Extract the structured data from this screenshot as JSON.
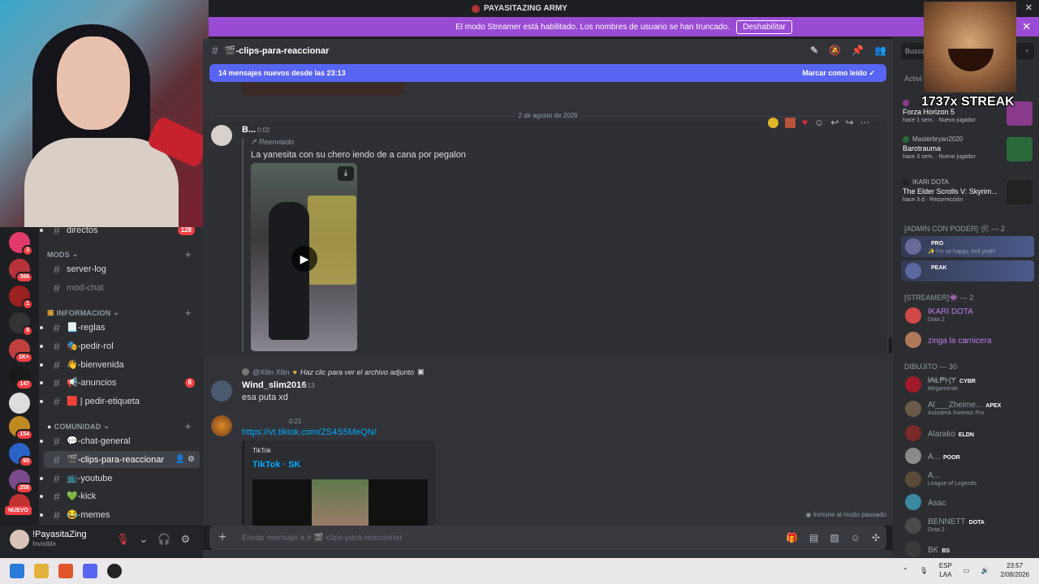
{
  "window": {
    "title": "PAYASITAZING ARMY",
    "controls": [
      "—",
      "☐",
      "✕"
    ]
  },
  "banner": {
    "text": "El modo Streamer está habilitado. Los nombres de usuario se han truncado.",
    "button": "Deshabilitar",
    "close": "✕"
  },
  "servers": [
    {
      "badge": "3",
      "color": "#e23a6a"
    },
    {
      "badge": "366",
      "color": "#b8323a"
    },
    {
      "badge": "1",
      "color": "#9b2020"
    },
    {
      "badge": "8",
      "color": "#333"
    },
    {
      "badge": "1K+",
      "color": "#c04040"
    },
    {
      "badge": "147",
      "color": "#1a1a1a"
    },
    {
      "badge": "",
      "color": "#ddd"
    },
    {
      "badge": "154",
      "color": "#c08a22",
      "label": "GATITOS ARMY"
    },
    {
      "badge": "60",
      "color": "#2a62c8"
    },
    {
      "badge": "258",
      "color": "#7a4a8a"
    },
    {
      "badge": "",
      "color": "#c03030"
    }
  ],
  "server_new_label": "NUEVO",
  "channels": {
    "top": {
      "name": "directos",
      "badge": "128"
    },
    "cat_mods": "MODS",
    "mods": [
      {
        "name": "server-log",
        "muted": false
      },
      {
        "name": "mod-chat",
        "muted": true
      }
    ],
    "cat_info": "INFORMACION",
    "info": [
      {
        "name": "📃-reglas"
      },
      {
        "name": "🎭-pedir-rol"
      },
      {
        "name": "👋-bienvenida"
      },
      {
        "name": "📢-anuncios",
        "badge": "8"
      },
      {
        "name": "🟥 | pedir-etiqueta"
      }
    ],
    "cat_com": "COMUNIDAD",
    "com": [
      {
        "name": "💬-chat-general"
      },
      {
        "name": "🎬-clips-para-reaccionar",
        "selected": true
      },
      {
        "name": "📺-youtube"
      },
      {
        "name": "💚-kick"
      },
      {
        "name": "😂-memes"
      }
    ]
  },
  "user": {
    "name": "!PayasitaZing",
    "status": "Invisible"
  },
  "header": {
    "channel": "🎬-clips-para-reaccionar"
  },
  "newbar": {
    "text": "14 mensajes nuevos desde las 23:13",
    "mark": "Marcar como leído"
  },
  "messages": {
    "date_divider": "2 de agosto de 2026",
    "m1": {
      "author": "B...",
      "time": "0:02",
      "forwarded": "Reenviado",
      "text": "La yanesita con su chero iendo de a cana por pegalon"
    },
    "m2": {
      "reply_user": "@Xilin Xilin",
      "reply_text": "Haz clic para ver el archivo adjunto",
      "author": "Wind_slim2016",
      "time": "0:13",
      "text": "esa puta xd"
    },
    "m3": {
      "time": "0:21",
      "link": "https://vt.tiktok.com/ZS4S5MeQN/",
      "embed_provider": "TikTok",
      "embed_title": "TikTok · SK"
    },
    "slowmode": "Inmune al modo pausado"
  },
  "composer": {
    "placeholder": "Enviar mensaje a # 🎬-clips-para-reaccionar"
  },
  "sidebar": {
    "search": "Busca",
    "now": "Activi",
    "activities": [
      {
        "who": "",
        "game": "Forza Horizon 5",
        "meta": "hace 1 sem. · Nuevo jugador",
        "color": "#8a3a8a"
      },
      {
        "who": "Masterbryan2020",
        "game": "Barotrauma",
        "meta": "hace 3 sem. · Nuevo jugador",
        "color": "#2a6a3a"
      },
      {
        "who": "IKARI DOTA",
        "game": "The Elder Scrolls V: Skyrim...",
        "meta": "hace 3 d · Resurrección",
        "color": "#222"
      }
    ],
    "group_admin": "[ADMIN CON PODER] 🛠 — 2",
    "admins": [
      {
        "name": "",
        "sub": "✨ I'm so happy, hell yeah!",
        "tag": "PRO",
        "color": "#6a6a9a"
      },
      {
        "name": "",
        "sub": "",
        "tag": "PEAK",
        "color": "#5a6aa0"
      }
    ],
    "group_streamer": "[STREAMER]👾 — 2",
    "streamers": [
      {
        "name": "IKARI DOTA",
        "sub": "Dota 2",
        "color": "#d04848"
      },
      {
        "name": "zinga la carnicera",
        "sub": "",
        "color": "#b07a5a"
      }
    ],
    "group_dibujito": "DIBUJITO — 30",
    "dibujito": [
      {
        "name": "ł₳Ⱡ₱ⱧɎ",
        "sub": "Megamente",
        "tag": "CYBR",
        "color": "#a01a2a"
      },
      {
        "name": "Al___Zheime...",
        "sub": "Autodesk Inventor Pro",
        "tag": "APEX",
        "color": "#6a5a4a"
      },
      {
        "name": "Alarako",
        "sub": "",
        "tag": "ELDN",
        "color": "#7a2a2a"
      },
      {
        "name": "A...",
        "sub": "",
        "tag": "POOR",
        "color": "#8a8a8a"
      },
      {
        "name": "A...",
        "sub": "League of Legends",
        "tag": "",
        "color": "#5a4a3a"
      },
      {
        "name": "Asac",
        "sub": "",
        "tag": "",
        "color": "#3a8aa0"
      },
      {
        "name": "BENNETT",
        "sub": "Dota 2",
        "tag": "DOTA",
        "color": "#4a4a4a"
      },
      {
        "name": "BK",
        "sub": "",
        "tag": "BS",
        "color": "#3a3a3a"
      }
    ]
  },
  "overlay": {
    "streak": "1737x STREAK"
  },
  "taskbar": {
    "lang1": "ESP",
    "lang2": "LAA",
    "time": "23:57",
    "date": "2/08/2026"
  }
}
